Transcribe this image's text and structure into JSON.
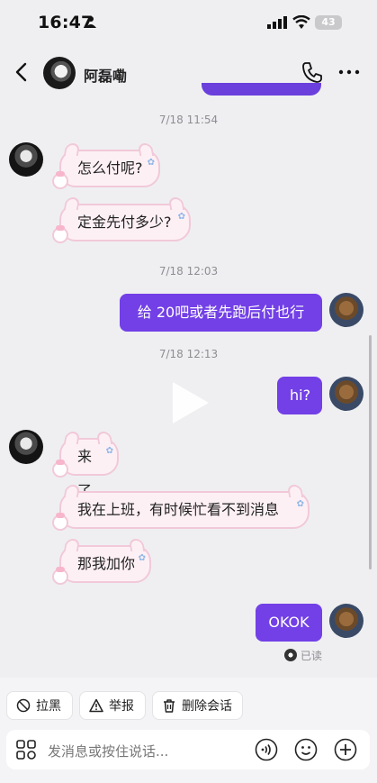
{
  "status_bar": {
    "time": "16:47",
    "battery": "43"
  },
  "header": {
    "name": "阿磊嘞"
  },
  "messages": [
    {
      "timestamp": "7/18 11:54"
    },
    {
      "text": "怎么付呢?"
    },
    {
      "text": "定金先付多少?"
    },
    {
      "timestamp": "7/18 12:03"
    },
    {
      "text": "给 20吧或者先跑后付也行"
    },
    {
      "timestamp": "7/18 12:13"
    },
    {
      "text": "hi?"
    },
    {
      "text": "来了"
    },
    {
      "text": "我在上班，有时候忙看不到消息"
    },
    {
      "text": "那我加你"
    },
    {
      "text": "OKOK"
    }
  ],
  "read_label": "已读",
  "actions": {
    "block": "拉黑",
    "report": "举报",
    "delete": "删除会话"
  },
  "input": {
    "placeholder": "发消息或按住说话..."
  },
  "colors": {
    "accent": "#7240e6",
    "bubble_in": "#fdf0f5"
  }
}
